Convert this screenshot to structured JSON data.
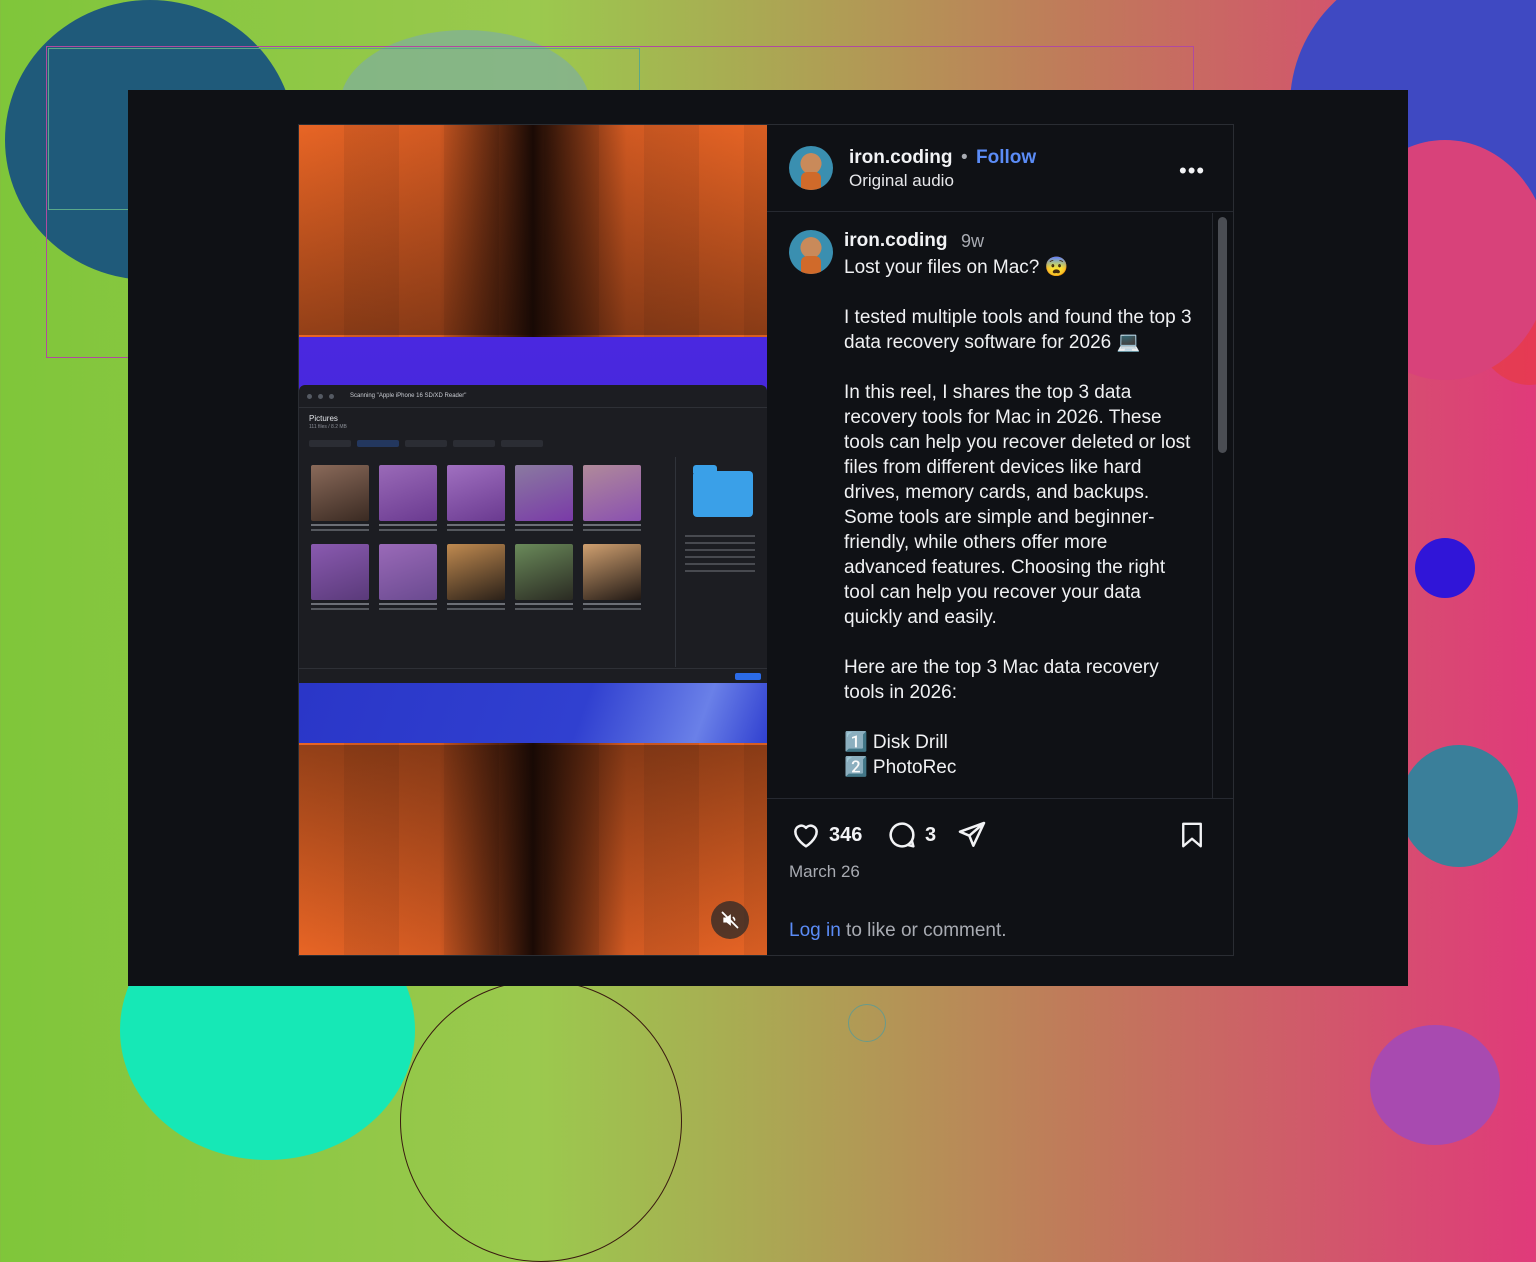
{
  "post": {
    "username": "iron.coding",
    "separator": "•",
    "follow_label": "Follow",
    "audio": "Original audio",
    "more_label": "•••",
    "caption_username": "iron.coding",
    "caption_time": "9w",
    "caption_text": "Lost your files on Mac? 😨\n\nI tested multiple tools and found the top 3 data recovery software for 2026 💻\n\nIn this reel, I shares the top 3 data recovery tools for Mac in 2026. These tools can help you recover deleted or lost files from different devices like hard drives, memory cards, and backups. Some tools are simple and beginner-friendly, while others offer more advanced features. Choosing the right tool can help you recover your data quickly and easily.\n\nHere are the top 3 Mac data recovery tools in 2026:\n\n1️⃣ Disk Drill\n2️⃣ PhotoRec",
    "likes": "346",
    "comments": "3",
    "date": "March 26",
    "login_link": "Log in",
    "login_rest": " to like or comment."
  },
  "video": {
    "app_title": "Scanning \"Apple iPhone 16 SD/XD Reader\"",
    "folder_heading": "Pictures",
    "folder_sub": "111 files / 8.2 MB",
    "muted": true
  },
  "colors": {
    "accent": "#5b8cf6",
    "panel_bg": "#0f1115",
    "video_orange": "#e86525"
  },
  "icons": {
    "like": "heart-icon",
    "comment": "comment-icon",
    "share": "share-icon",
    "save": "bookmark-icon",
    "mute": "speaker-muted-icon"
  }
}
